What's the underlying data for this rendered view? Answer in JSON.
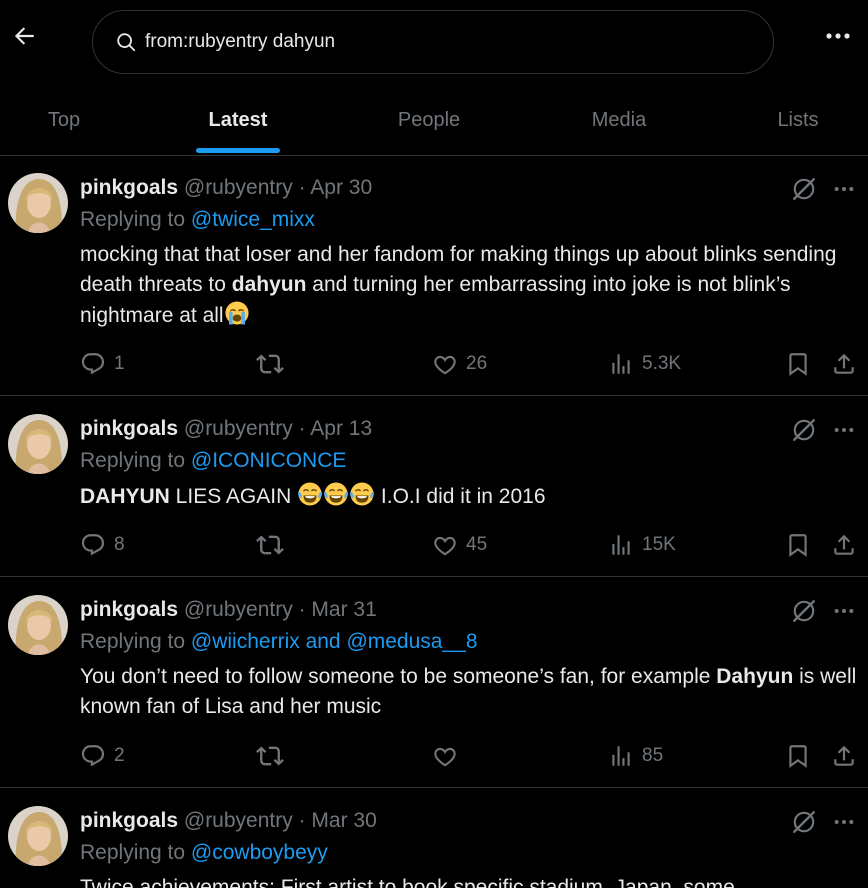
{
  "search": {
    "query": "from:rubyentry dahyun"
  },
  "tabs": [
    {
      "label": "Top"
    },
    {
      "label": "Latest"
    },
    {
      "label": "People"
    },
    {
      "label": "Media"
    },
    {
      "label": "Lists"
    }
  ],
  "active_tab": "Latest",
  "tweets": [
    {
      "name": "pinkgoals",
      "handle": "@rubyentry",
      "date": "Apr 30",
      "replying_prefix": "Replying to",
      "replying_to": "@twice_mixx",
      "body_1": "mocking that that loser and her fandom for making things up about blinks sending death threats to ",
      "body_bold": "dahyun",
      "body_2": " and turning her embarrassing into joke is not blink’s nightmare at all",
      "emoji": "loudly-crying-face",
      "replies": "1",
      "reposts": "",
      "likes": "26",
      "views": "5.3K"
    },
    {
      "name": "pinkgoals",
      "handle": "@rubyentry",
      "date": "Apr 13",
      "replying_prefix": "Replying to",
      "replying_to": "@ICONICONCE",
      "body_bold": "DAHYUN",
      "body_1": " LIES AGAIN ",
      "body_2": " I.O.I did it in 2016",
      "emoji": "face-with-tears-of-joy x3",
      "replies": "8",
      "reposts": "",
      "likes": "45",
      "views": "15K"
    },
    {
      "name": "pinkgoals",
      "handle": "@rubyentry",
      "date": "Mar 31",
      "replying_prefix": "Replying to",
      "replying_to": "@wiicherrix and @medusa__8",
      "body_1": "You don’t need to follow someone to be someone’s fan, for example ",
      "body_bold": "Dahyun",
      "body_2": " is well known fan of Lisa and her music",
      "replies": "2",
      "reposts": "",
      "likes": "",
      "views": "85"
    },
    {
      "name": "pinkgoals",
      "handle": "@rubyentry",
      "date": "Mar 30",
      "replying_prefix": "Replying to",
      "replying_to": "@cowboybeyy",
      "body_1": "Twice achievements: First artist to book specific stadium, Japan, some"
    }
  ],
  "meta_separator": "·",
  "colors": {
    "background": "#000000",
    "accent": "#1d9bf0",
    "text": "#e7e9ea",
    "muted": "#71767b",
    "border": "#2f3336"
  }
}
